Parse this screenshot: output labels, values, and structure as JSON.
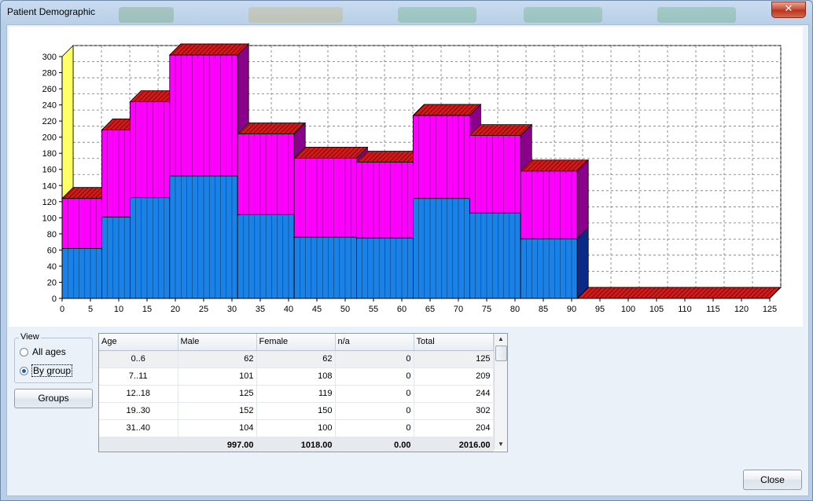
{
  "window": {
    "title": "Patient Demographic",
    "close_glyph": "✕"
  },
  "view": {
    "legend": "View",
    "options": [
      {
        "label": "All ages",
        "checked": false
      },
      {
        "label": "By group",
        "checked": true
      }
    ]
  },
  "buttons": {
    "groups": "Groups",
    "close": "Close"
  },
  "table": {
    "headers": [
      "Age",
      "Male",
      "Female",
      "n/a",
      "Total"
    ],
    "rows": [
      [
        "0..6",
        "62",
        "62",
        "0",
        "125"
      ],
      [
        "7..11",
        "101",
        "108",
        "0",
        "209"
      ],
      [
        "12..18",
        "125",
        "119",
        "0",
        "244"
      ],
      [
        "19..30",
        "152",
        "150",
        "0",
        "302"
      ],
      [
        "31..40",
        "104",
        "100",
        "0",
        "204"
      ]
    ],
    "totals": [
      "",
      "997.00",
      "1018.00",
      "0.00",
      "2016.00"
    ]
  },
  "chart_data": {
    "type": "bar",
    "stacked": true,
    "three_d": true,
    "grid": true,
    "xlim": [
      0,
      125
    ],
    "ylim": [
      0,
      300
    ],
    "x_ticks": [
      0,
      5,
      10,
      15,
      20,
      25,
      30,
      35,
      40,
      45,
      50,
      55,
      60,
      65,
      70,
      75,
      80,
      85,
      90,
      95,
      100,
      105,
      110,
      115,
      120,
      125
    ],
    "y_ticks": [
      0,
      20,
      40,
      60,
      80,
      100,
      120,
      140,
      160,
      180,
      200,
      220,
      240,
      260,
      280,
      300
    ],
    "groups": [
      {
        "from": 0,
        "to": 7,
        "male": 62,
        "female": 62
      },
      {
        "from": 7,
        "to": 12,
        "male": 101,
        "female": 108
      },
      {
        "from": 12,
        "to": 19,
        "male": 125,
        "female": 119
      },
      {
        "from": 19,
        "to": 31,
        "male": 152,
        "female": 150
      },
      {
        "from": 31,
        "to": 41,
        "male": 104,
        "female": 100
      },
      {
        "from": 41,
        "to": 52,
        "male": 76,
        "female": 98
      },
      {
        "from": 52,
        "to": 62,
        "male": 75,
        "female": 94
      },
      {
        "from": 62,
        "to": 72,
        "male": 124,
        "female": 103
      },
      {
        "from": 72,
        "to": 81,
        "male": 106,
        "female": 96
      },
      {
        "from": 81,
        "to": 91,
        "male": 74,
        "female": 84
      },
      {
        "from": 91,
        "to": 125,
        "male": 0,
        "female": 0
      }
    ],
    "colors": {
      "male": "#1a82e6",
      "female": "#ff00ff",
      "cap": "#d11a1a",
      "wall": "#ffff66"
    }
  }
}
